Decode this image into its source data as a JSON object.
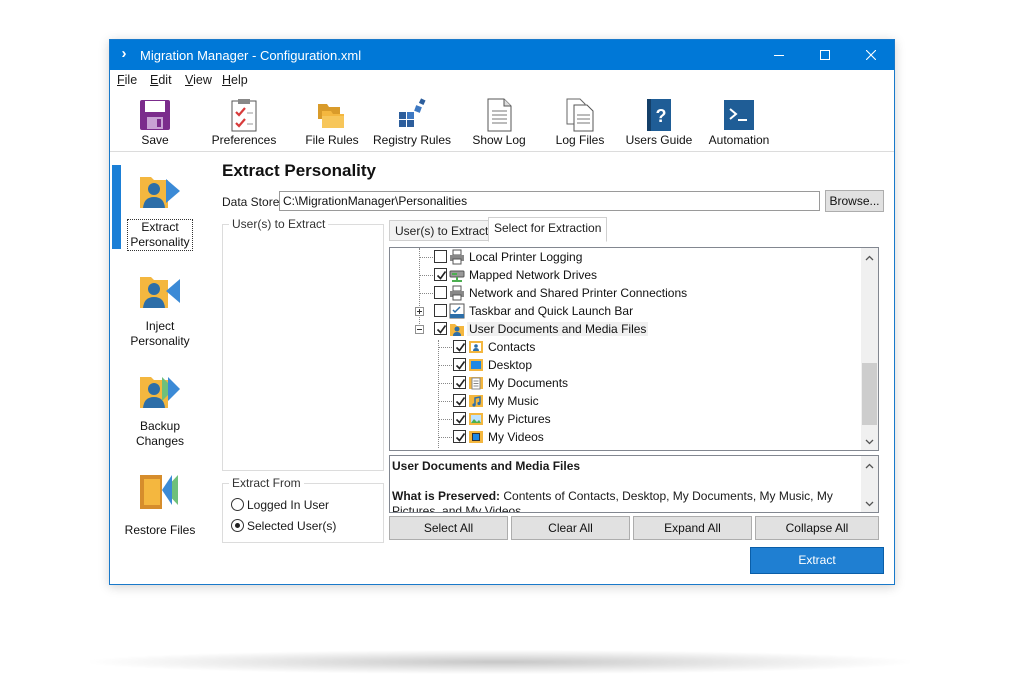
{
  "window": {
    "title": "Migration Manager - Configuration.xml",
    "app_icon": "chevron-right-icon"
  },
  "menu": [
    {
      "label": "File",
      "accel": "F",
      "rest": "ile"
    },
    {
      "label": "Edit",
      "accel": "E",
      "rest": "dit"
    },
    {
      "label": "View",
      "accel": "V",
      "rest": "iew"
    },
    {
      "label": "Help",
      "accel": "H",
      "rest": "elp"
    }
  ],
  "toolbar": {
    "save": "Save",
    "preferences": "Preferences",
    "file_rules": "File Rules",
    "registry_rules": "Registry Rules",
    "show_log": "Show Log",
    "log_files": "Log Files",
    "users_guide": "Users Guide",
    "automation": "Automation"
  },
  "sidebar": {
    "extract_1": "Extract",
    "extract_2": "Personality",
    "inject_1": "Inject",
    "inject_2": "Personality",
    "backup_1": "Backup",
    "backup_2": "Changes",
    "restore": "Restore Files"
  },
  "page": {
    "title": "Extract Personality",
    "data_store_label": "Data Store",
    "data_store_value": "C:\\MigrationManager\\Personalities",
    "browse": "Browse..."
  },
  "users_group": {
    "title": "User(s) to Extract"
  },
  "extract_from": {
    "title": "Extract From",
    "option_logged_in": "Logged In User",
    "option_selected": "Selected User(s)",
    "selected": "Selected User(s)"
  },
  "tabs": [
    {
      "label": "User(s) to Extract",
      "active": false
    },
    {
      "label": "Select for Extraction",
      "active": true
    }
  ],
  "tree": [
    {
      "label": "Local Printer Logging",
      "checked": false,
      "icon": "printer-icon"
    },
    {
      "label": "Mapped Network Drives",
      "checked": true,
      "icon": "network-drive-icon"
    },
    {
      "label": "Network and Shared Printer Connections",
      "checked": false,
      "icon": "printer-icon"
    },
    {
      "label": "Taskbar and Quick Launch Bar",
      "checked": false,
      "icon": "taskbar-icon",
      "expander": "plus"
    },
    {
      "label": "User Documents and Media Files",
      "checked": true,
      "icon": "user-folder-icon",
      "expander": "minus",
      "selected": true
    },
    {
      "label": "Contacts",
      "checked": true,
      "icon": "contacts-icon"
    },
    {
      "label": "Desktop",
      "checked": true,
      "icon": "desktop-icon"
    },
    {
      "label": "My Documents",
      "checked": true,
      "icon": "document-icon"
    },
    {
      "label": "My Music",
      "checked": true,
      "icon": "music-icon"
    },
    {
      "label": "My Pictures",
      "checked": true,
      "icon": "pictures-icon"
    },
    {
      "label": "My Videos",
      "checked": true,
      "icon": "video-icon"
    }
  ],
  "description": {
    "title": "User Documents and Media Files",
    "lead": "What is Preserved:",
    "body": "Contents of Contacts, Desktop, My Documents, My Music, My Pictures, and My Videos"
  },
  "buttons": {
    "select_all": "Select All",
    "clear_all": "Clear All",
    "expand_all": "Expand All",
    "collapse_all": "Collapse All",
    "extract": "Extract"
  },
  "colors": {
    "titlebar": "#0078d7",
    "accent": "#1f7fd2",
    "folder": "#f4b73f",
    "person": "#2d6ea8"
  }
}
